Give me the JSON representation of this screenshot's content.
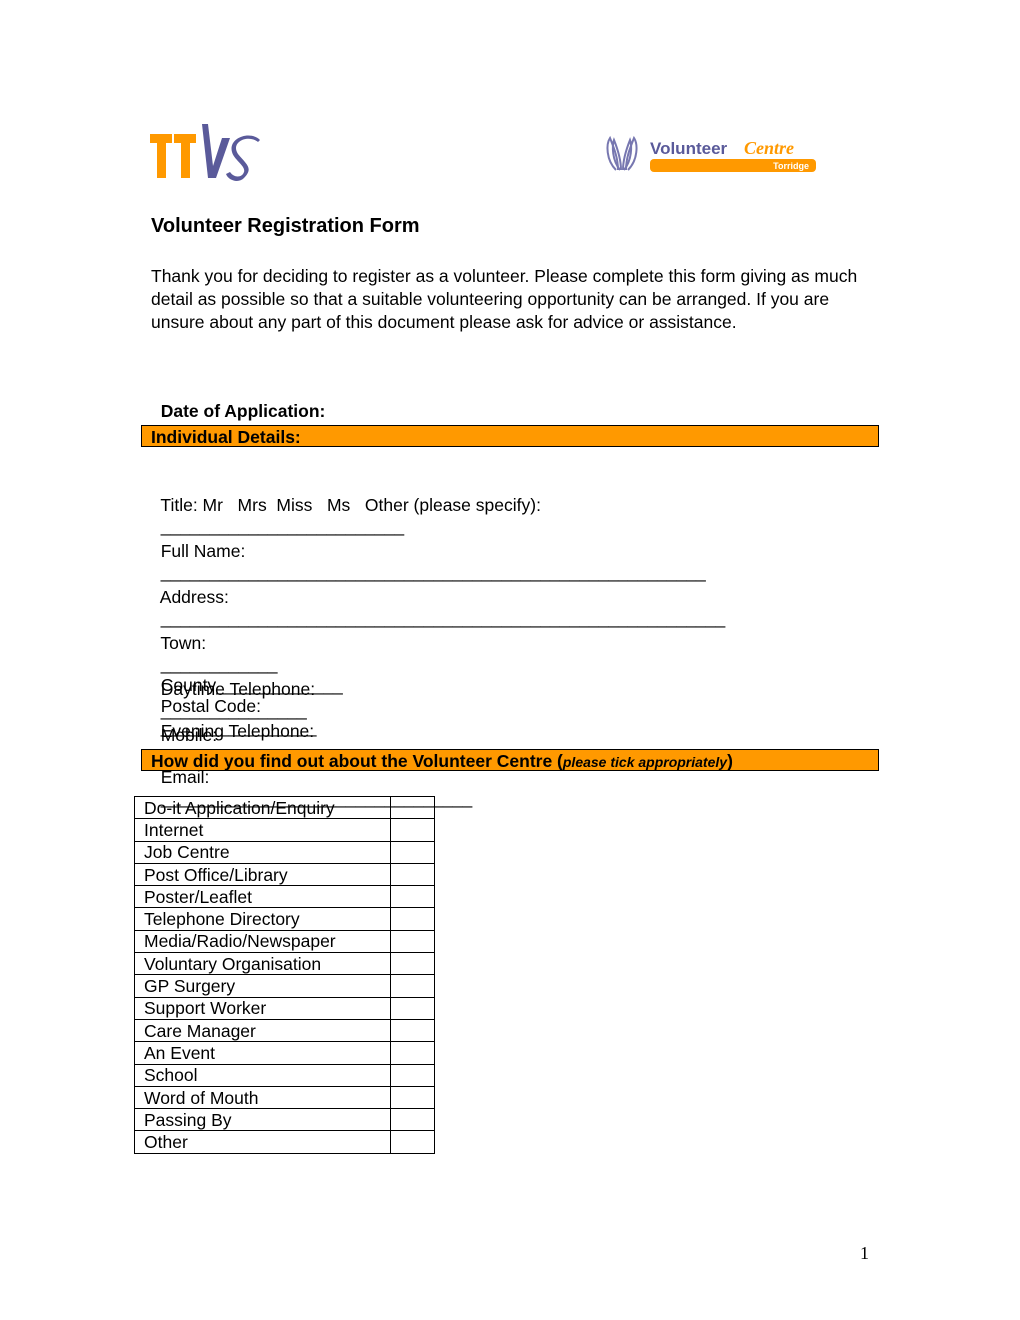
{
  "logos": {
    "left": {
      "name": "TTVS",
      "text_orange": "TT",
      "text_purple": "VS"
    },
    "right": {
      "name": "Volunteer Centre Torridge",
      "word1": "Volunteer",
      "word2": "Centre",
      "subtitle": "Torridge"
    }
  },
  "colors": {
    "orange": "#ff9900",
    "purple": "#5a5a9a"
  },
  "title": "Volunteer Registration Form",
  "intro": "Thank you for deciding to register as a volunteer. Please complete this form giving as much detail as possible so that a suitable volunteering opportunity can be arranged. If you are unsure about any part of this document please ask for advice or assistance.",
  "date_of_application": {
    "label": "Date of Application:",
    "blank": "_______________________"
  },
  "sections": {
    "individual_details": "Individual Details:",
    "how_found": {
      "main": "How did you find out about the Volunteer Centre (",
      "italic": "please tick appropriately",
      "close": ")"
    }
  },
  "fields": {
    "title_line": {
      "label": "Title: Mr   Mrs  Miss   Ms   Other (please specify):",
      "blank": "_________________________"
    },
    "full_name": {
      "label": "Full Name:",
      "blank": "________________________________________________________"
    },
    "address": {
      "label": "Address:",
      "blank": "__________________________________________________________"
    },
    "town": {
      "label": "Town:",
      "blank": "____________"
    },
    "county": {
      "label": "County",
      "blank": "_____________"
    },
    "postal_code": {
      "label": "Postal Code:",
      "blank": "________________"
    },
    "daytime_tel": {
      "label": "Daytime Telephone:",
      "blank": "_______________"
    },
    "evening_tel": {
      "label": "Evening Telephone:",
      "blank": "________________"
    },
    "mobile": {
      "label": "Mobile:",
      "blank": "____________________"
    },
    "email": {
      "label": "Email:",
      "blank": "________________________________"
    }
  },
  "sources": [
    "Do-it Application/Enquiry",
    "Internet",
    "Job Centre",
    "Post Office/Library",
    "Poster/Leaflet",
    "Telephone Directory",
    "Media/Radio/Newspaper",
    "Voluntary Organisation",
    "GP Surgery",
    "Support Worker",
    "Care Manager",
    "An Event",
    "School",
    "Word of Mouth",
    "Passing By",
    "Other"
  ],
  "page_number": "1"
}
